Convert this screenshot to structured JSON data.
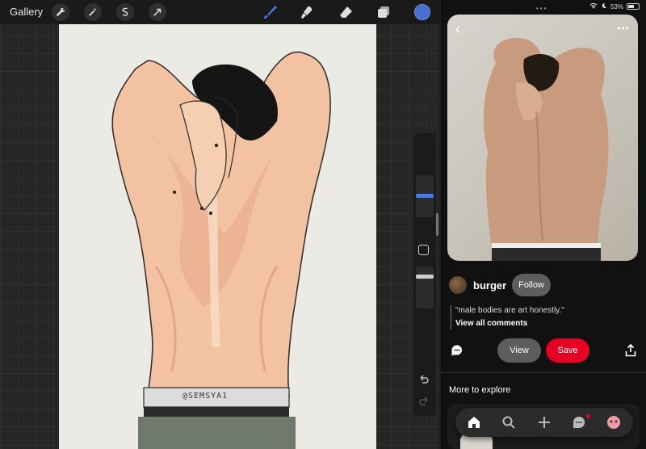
{
  "procreate": {
    "gallery_label": "Gallery",
    "toolbar_icons": [
      "wrench-icon",
      "magic-wand-icon",
      "selection-icon",
      "arrow-icon"
    ],
    "tools": [
      "brush-icon",
      "smudge-icon",
      "eraser-icon",
      "layers-icon"
    ],
    "current_color": "#4a6fd1",
    "signature": "@SEMSYA1"
  },
  "pinterest": {
    "status": {
      "battery": "53%"
    },
    "pin": {
      "username": "burger",
      "follow_label": "Follow",
      "comment": "\"male bodies are art honestly.\"",
      "view_all_comments": "View all comments",
      "view_label": "View",
      "save_label": "Save"
    },
    "more_to_explore": "More to explore",
    "nav_icons": [
      "home-icon",
      "search-icon",
      "create-icon",
      "messages-icon",
      "profile-icon"
    ],
    "colors": {
      "save_red": "#e60023"
    }
  }
}
